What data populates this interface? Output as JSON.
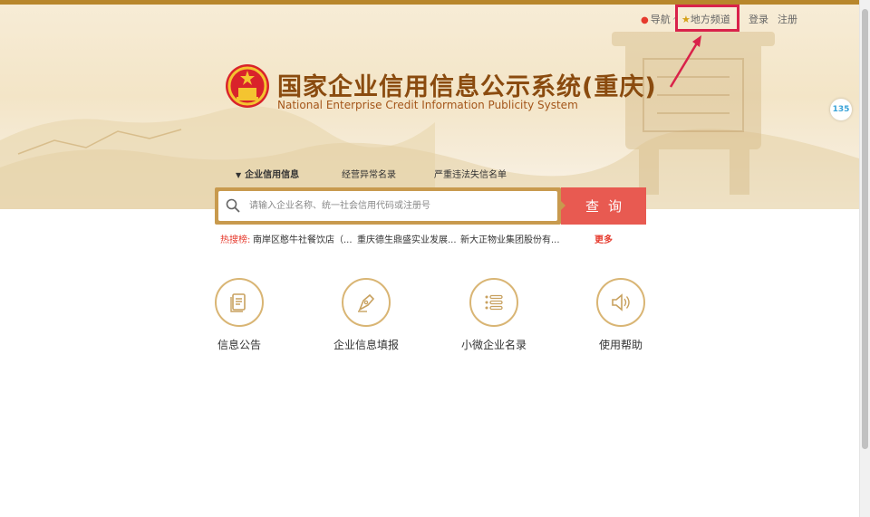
{
  "header": {
    "nav": {
      "navigation": "导航",
      "local_channel": "地方频道",
      "login": "登录",
      "register": "注册"
    },
    "title_cn": "国家企业信用信息公示系统(重庆)",
    "title_en": "National Enterprise Credit Information Publicity System",
    "side_badge": "135"
  },
  "tabs": [
    {
      "label": "企业信用信息",
      "active": true
    },
    {
      "label": "经营异常名录"
    },
    {
      "label": "严重违法失信名单"
    }
  ],
  "search": {
    "placeholder": "请输入企业名称、统一社会信用代码或注册号",
    "button_label": "查询"
  },
  "hot_search": {
    "label": "热搜榜:",
    "items": [
      "南岸区憨牛社餐饮店（...",
      "重庆德生鼎盛实业发展...",
      "新大正物业集团股份有..."
    ],
    "more": "更多"
  },
  "quick_links": [
    {
      "label": "信息公告",
      "icon": "document-icon"
    },
    {
      "label": "企业信息填报",
      "icon": "pen-nib-icon"
    },
    {
      "label": "小微企业名录",
      "icon": "list-icon"
    },
    {
      "label": "使用帮助",
      "icon": "speaker-icon"
    }
  ],
  "colors": {
    "gold": "#c89a4e",
    "title_brown": "#8a4b0f",
    "search_red": "#e85a51",
    "highlight_red": "#d9224a",
    "hot_red": "#e63b2e"
  }
}
